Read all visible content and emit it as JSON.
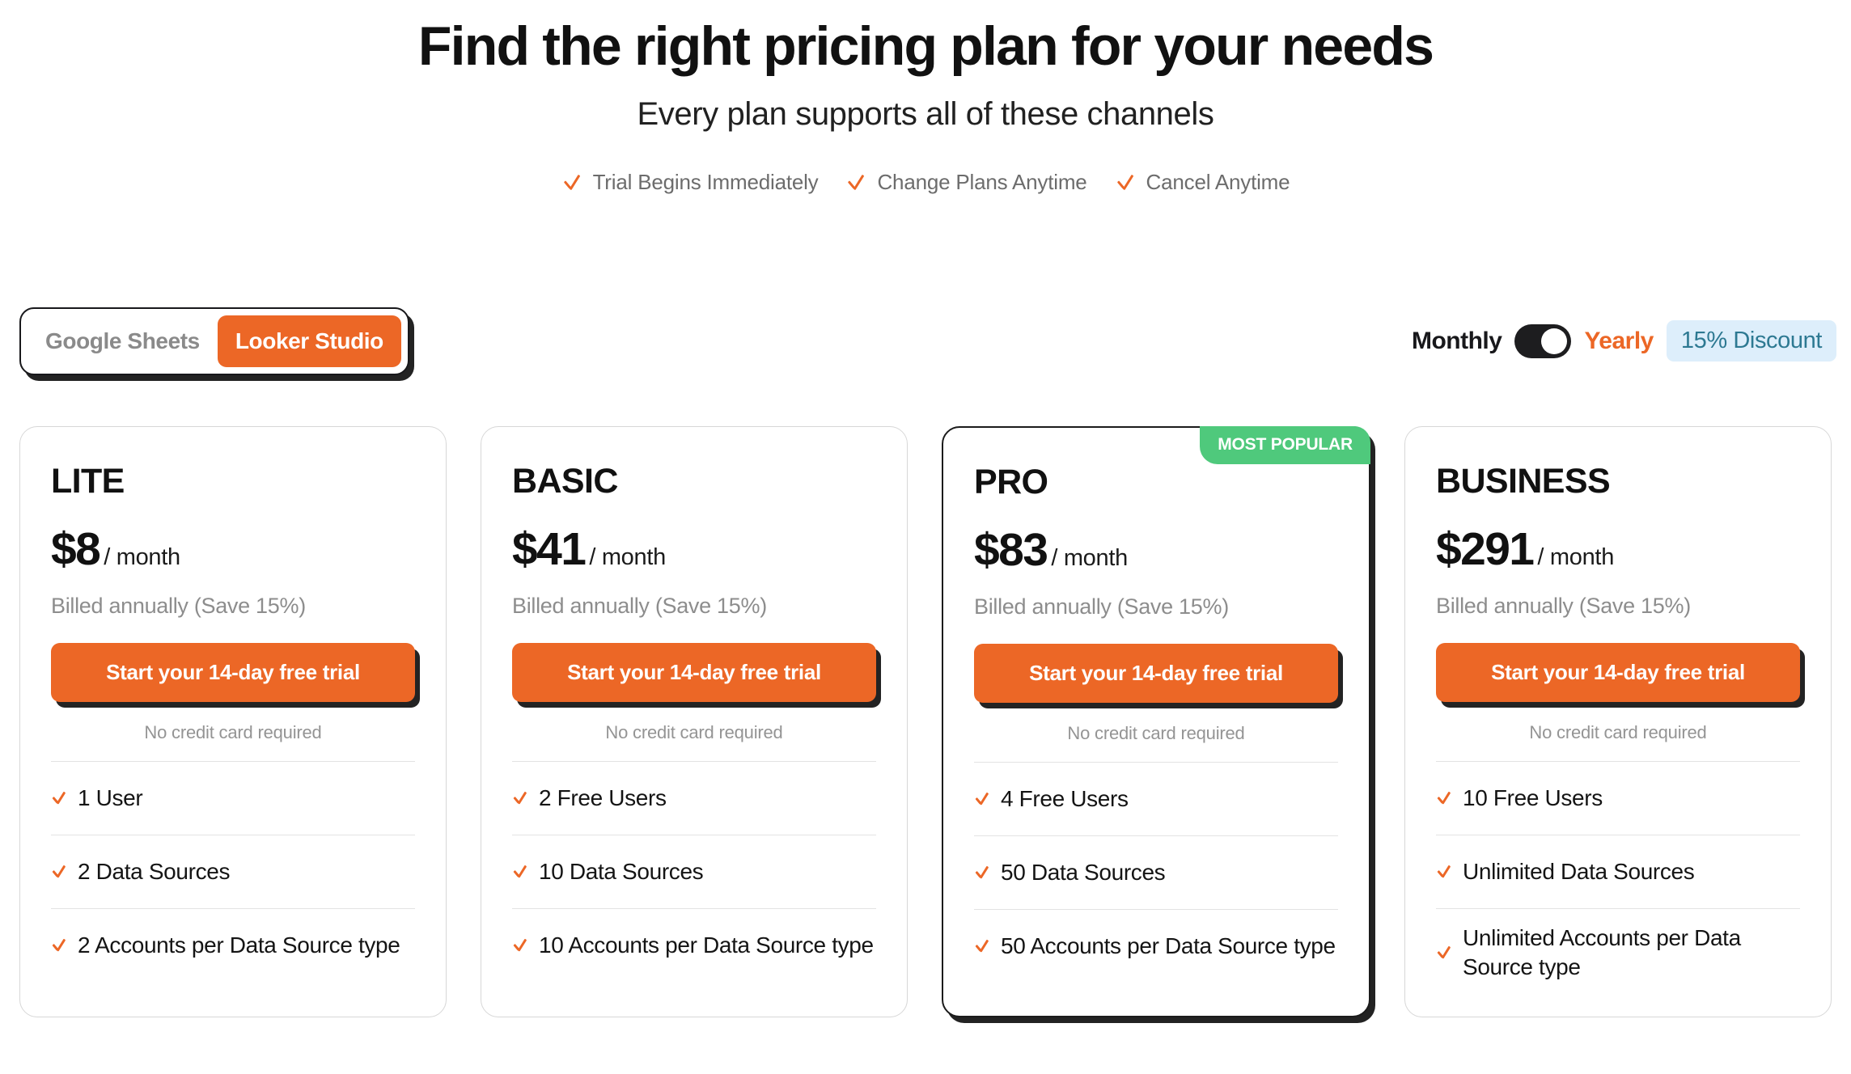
{
  "header": {
    "title": "Find the right pricing plan for your needs",
    "subtitle": "Every plan supports all of these channels",
    "assurances": [
      {
        "label": "Trial Begins Immediately"
      },
      {
        "label": "Change Plans Anytime"
      },
      {
        "label": "Cancel Anytime"
      }
    ]
  },
  "controls": {
    "platform_switch": {
      "options": [
        {
          "label": "Google Sheets",
          "selected": false
        },
        {
          "label": "Looker Studio",
          "selected": true
        }
      ]
    },
    "billing": {
      "monthly_label": "Monthly",
      "yearly_label": "Yearly",
      "selected": "Yearly",
      "discount_label": "15% Discount"
    }
  },
  "colors": {
    "accent_orange": "#ec6726",
    "badge_green": "#4fc97c",
    "discount_text": "#2d7992",
    "discount_bg": "#ddeefb",
    "shadow": "#232323"
  },
  "plans": [
    {
      "name": "LITE",
      "price": "$8",
      "period": "/ month",
      "billed_note": "Billed annually (Save 15%)",
      "cta_label": "Start your 14-day free trial",
      "no_card_note": "No credit card required",
      "featured": false,
      "badge": "",
      "features": [
        {
          "label": "1 User"
        },
        {
          "label": "2 Data Sources"
        },
        {
          "label": "2 Accounts per Data Source type"
        }
      ]
    },
    {
      "name": "BASIC",
      "price": "$41",
      "period": "/ month",
      "billed_note": "Billed annually (Save 15%)",
      "cta_label": "Start your 14-day free trial",
      "no_card_note": "No credit card required",
      "featured": false,
      "badge": "",
      "features": [
        {
          "label": "2 Free Users"
        },
        {
          "label": "10 Data Sources"
        },
        {
          "label": "10 Accounts per Data Source type"
        }
      ]
    },
    {
      "name": "PRO",
      "price": "$83",
      "period": "/ month",
      "billed_note": "Billed annually (Save 15%)",
      "cta_label": "Start your 14-day free trial",
      "no_card_note": "No credit card required",
      "featured": true,
      "badge": "MOST POPULAR",
      "features": [
        {
          "label": "4 Free Users"
        },
        {
          "label": "50 Data Sources"
        },
        {
          "label": "50 Accounts per Data Source type"
        }
      ]
    },
    {
      "name": "BUSINESS",
      "price": "$291",
      "period": "/ month",
      "billed_note": "Billed annually (Save 15%)",
      "cta_label": "Start your 14-day free trial",
      "no_card_note": "No credit card required",
      "featured": false,
      "badge": "",
      "features": [
        {
          "label": "10 Free Users"
        },
        {
          "label": "Unlimited Data Sources"
        },
        {
          "label": "Unlimited Accounts per Data Source type"
        }
      ]
    }
  ]
}
